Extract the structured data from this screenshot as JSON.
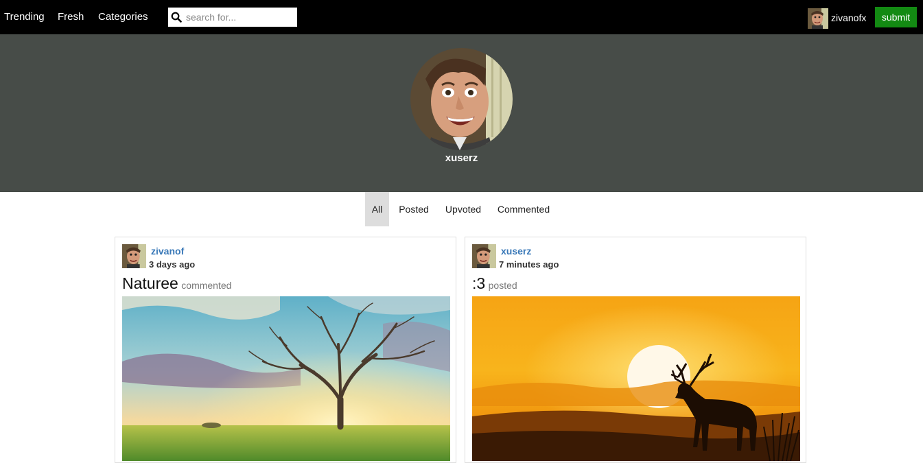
{
  "nav": {
    "items": [
      {
        "label": "Trending"
      },
      {
        "label": "Fresh"
      },
      {
        "label": "Categories"
      }
    ],
    "search_placeholder": "search for...",
    "search_value": "",
    "current_user": "zivanofx",
    "submit_label": "submit"
  },
  "profile": {
    "username": "xuserz"
  },
  "tabs": [
    {
      "label": "All",
      "active": true
    },
    {
      "label": "Posted",
      "active": false
    },
    {
      "label": "Upvoted",
      "active": false
    },
    {
      "label": "Commented",
      "active": false
    }
  ],
  "posts": [
    {
      "user": "zivanof",
      "time": "3 days ago",
      "title": "Naturee",
      "action": "commented",
      "image_icon": "tree-sunset-photo"
    },
    {
      "user": "xuserz",
      "time": "7 minutes ago",
      "title": ":3",
      "action": "posted",
      "image_icon": "deer-sunset-photo"
    }
  ],
  "colors": {
    "topbar_bg": "#000000",
    "profile_band_bg": "#474c48",
    "submit_bg": "#138a13",
    "username_link": "#3a79b8",
    "active_tab_bg": "#dddddd"
  }
}
